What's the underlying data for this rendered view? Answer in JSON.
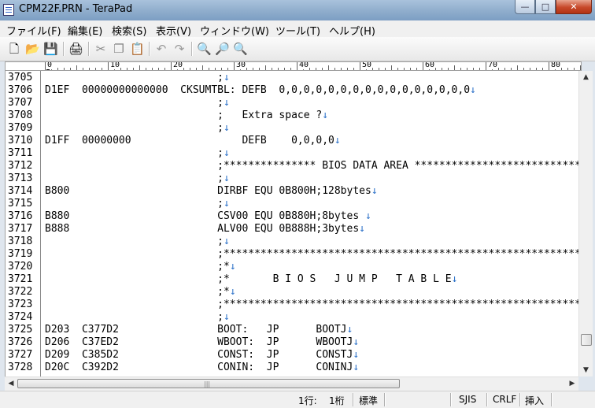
{
  "window": {
    "title": "CPM22F.PRN - TeraPad",
    "minimize": "—",
    "maximize": "□",
    "close": "✕"
  },
  "menu": [
    "ファイル(F)",
    "編集(E)",
    "検索(S)",
    "表示(V)",
    "ウィンドウ(W)",
    "ツール(T)",
    "ヘルプ(H)"
  ],
  "toolbar": {
    "icons": [
      "new-file-icon",
      "open-folder-icon",
      "save-icon",
      "print-icon",
      "cut-icon",
      "copy-icon",
      "paste-icon",
      "undo-icon",
      "redo-icon",
      "find-icon",
      "find-next-icon",
      "find-prev-icon"
    ],
    "glyphs": [
      "🗋",
      "📂",
      "💾",
      "🖨",
      "✂",
      "❐",
      "📋",
      "↶",
      "↷",
      "🔍",
      "🔎",
      "🔍"
    ]
  },
  "ruler": {
    "labels": [
      "0",
      "10",
      "20",
      "30",
      "40",
      "50",
      "60",
      "70",
      "80"
    ]
  },
  "editor": {
    "eol_color": "#2a70c8",
    "line_numbers": [
      "3705",
      "3706",
      "3707",
      "3708",
      "3709",
      "3710",
      "3711",
      "3712",
      "3713",
      "3714",
      "3715",
      "3716",
      "3717",
      "3718",
      "3719",
      "3720",
      "3721",
      "3722",
      "3723",
      "3724",
      "3725",
      "3726",
      "3727",
      "3728"
    ],
    "lines": [
      {
        "text": "                            ;",
        "eol": "↓"
      },
      {
        "text": "D1EF  00000000000000  CKSUMTBL: DEFB  0,0,0,0,0,0,0,0,0,0,0,0,0,0,0,0",
        "eol": "↓"
      },
      {
        "text": "                            ;",
        "eol": "↓"
      },
      {
        "text": "                            ;   Extra space ?",
        "eol": "↓"
      },
      {
        "text": "                            ;",
        "eol": "↓"
      },
      {
        "text": "D1FF  00000000                  DEFB    0,0,0,0",
        "eol": "↓"
      },
      {
        "text": "                            ;",
        "eol": "↓"
      },
      {
        "text": "                            ;*************** BIOS DATA AREA ********************************",
        "eol": ""
      },
      {
        "text": "                            ;",
        "eol": "↓"
      },
      {
        "text": "B800                        DIRBF EQU 0B800H;128bytes",
        "eol": "↓"
      },
      {
        "text": "                            ;",
        "eol": "↓"
      },
      {
        "text": "B880                        CSV00 EQU 0B880H;8bytes ",
        "eol": "↓"
      },
      {
        "text": "B888                        ALV00 EQU 0B888H;3bytes",
        "eol": "↓"
      },
      {
        "text": "                            ;",
        "eol": "↓"
      },
      {
        "text": "                            ;*************************************************************",
        "eol": ""
      },
      {
        "text": "                            ;*",
        "eol": "↓"
      },
      {
        "text": "                            ;*       B I O S   J U M P   T A B L E",
        "eol": "↓"
      },
      {
        "text": "                            ;*",
        "eol": "↓"
      },
      {
        "text": "                            ;*************************************************************",
        "eol": ""
      },
      {
        "text": "                            ;",
        "eol": "↓"
      },
      {
        "text": "D203  C377D2                BOOT:   JP      BOOTJ",
        "eol": "↓"
      },
      {
        "text": "D206  C37ED2                WBOOT:  JP      WBOOTJ",
        "eol": "↓"
      },
      {
        "text": "D209  C385D2                CONST:  JP      CONSTJ",
        "eol": "↓"
      },
      {
        "text": "D20C  C392D2                CONIN:  JP      CONINJ",
        "eol": "↓"
      }
    ]
  },
  "scrollbars": {
    "up": "▲",
    "down": "▼",
    "left": "◀",
    "right": "▶",
    "grip": "|||"
  },
  "status": {
    "line": "1行:",
    "col": "1桁",
    "mode": "標準",
    "encoding": "SJIS",
    "newline": "CRLF",
    "insert": "挿入"
  }
}
